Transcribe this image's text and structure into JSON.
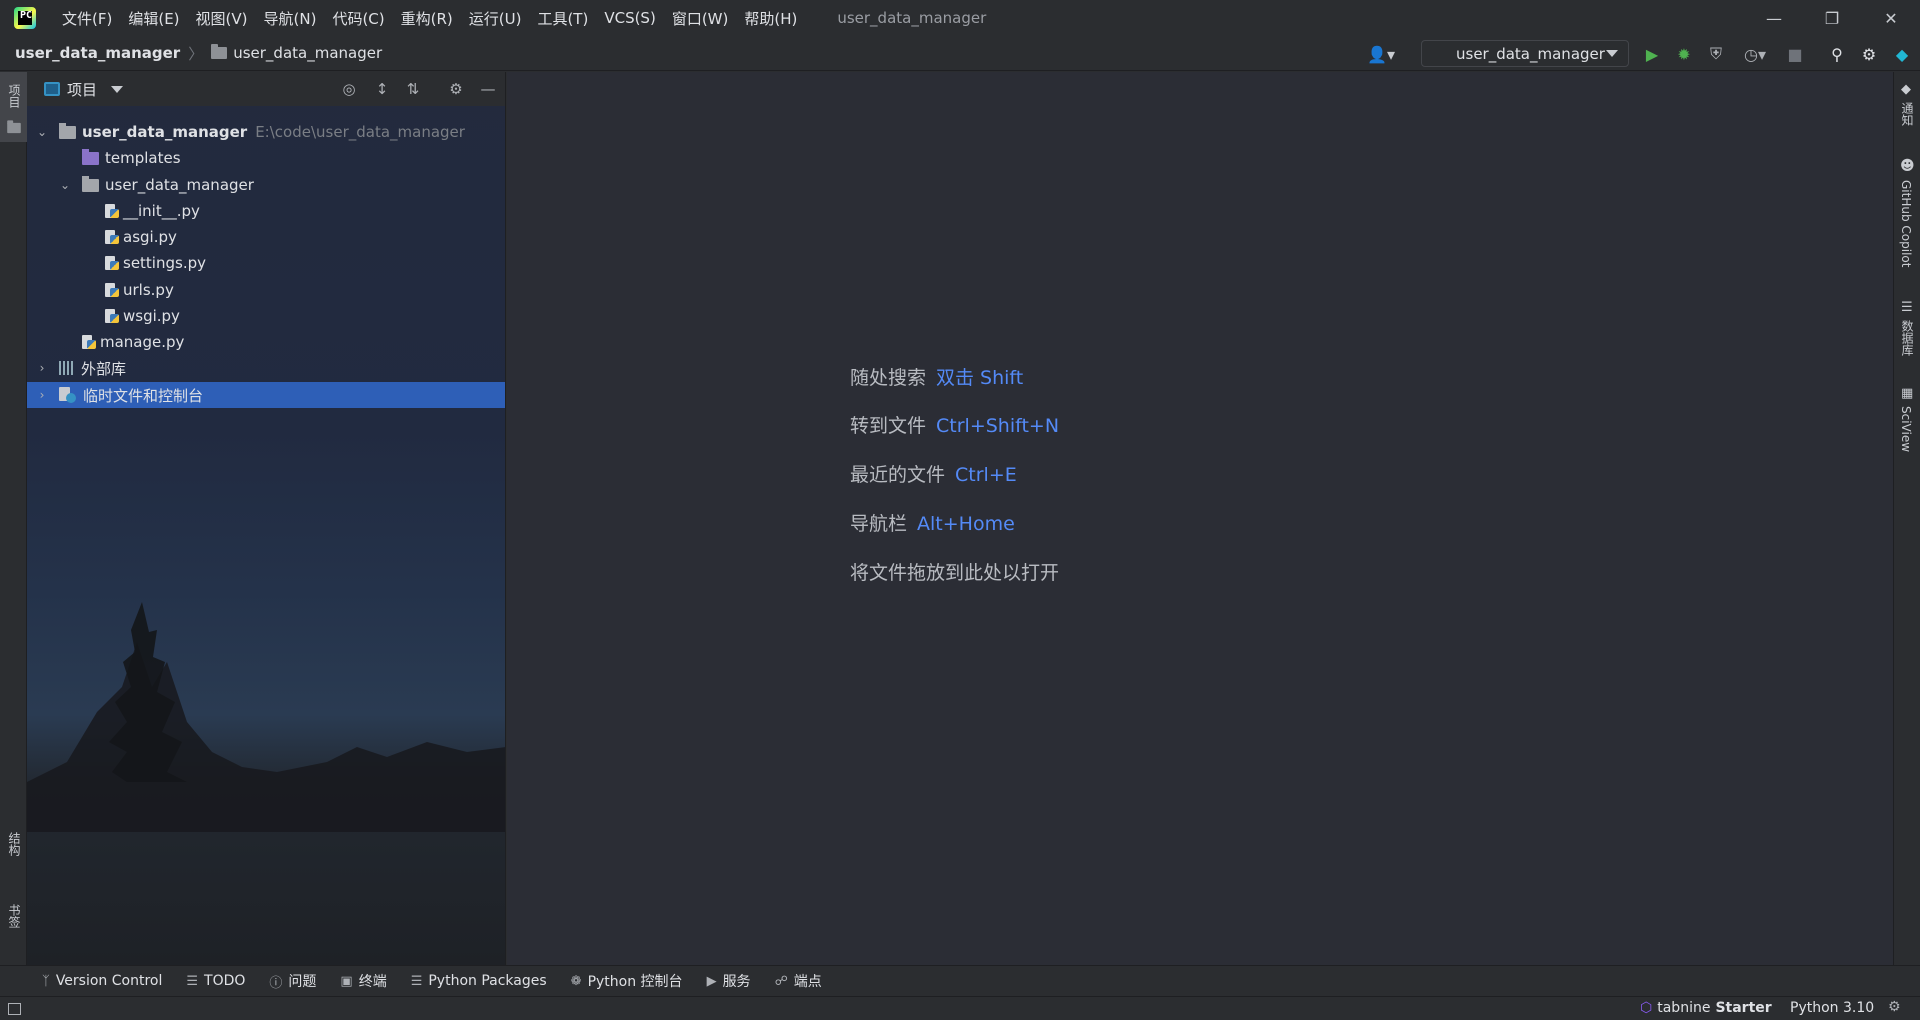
{
  "titlebar": {
    "menus": [
      "文件(F)",
      "编辑(E)",
      "视图(V)",
      "导航(N)",
      "代码(C)",
      "重构(R)",
      "运行(U)",
      "工具(T)",
      "VCS(S)",
      "窗口(W)",
      "帮助(H)"
    ],
    "title": "user_data_manager",
    "logo_text": "PC"
  },
  "navbar": {
    "root": "user_data_manager",
    "leaf": "user_data_manager",
    "run_config": "user_data_manager"
  },
  "left_strip": {
    "project": "项目",
    "structure": "结构",
    "bookmarks": "书签"
  },
  "project_panel": {
    "title": "项目",
    "tree": [
      {
        "label": "user_data_manager",
        "path": "E:\\code\\user_data_manager"
      },
      {
        "label": "templates"
      },
      {
        "label": "user_data_manager"
      },
      {
        "label": "__init__.py"
      },
      {
        "label": "asgi.py"
      },
      {
        "label": "settings.py"
      },
      {
        "label": "urls.py"
      },
      {
        "label": "wsgi.py"
      },
      {
        "label": "manage.py"
      },
      {
        "label": "外部库"
      },
      {
        "label": "临时文件和控制台"
      }
    ]
  },
  "editor": {
    "hints": [
      {
        "label": "随处搜索",
        "key": "双击 Shift"
      },
      {
        "label": "转到文件",
        "key": "Ctrl+Shift+N"
      },
      {
        "label": "最近的文件",
        "key": "Ctrl+E"
      },
      {
        "label": "导航栏",
        "key": "Alt+Home"
      },
      {
        "label": "将文件拖放到此处以打开",
        "key": ""
      }
    ]
  },
  "right_strip": {
    "notifications": "通知",
    "copilot": "GitHub Copilot",
    "database": "数据库",
    "sciview": "SciView"
  },
  "bottom_tools": [
    "Version Control",
    "TODO",
    "问题",
    "终端",
    "Python Packages",
    "Python 控制台",
    "服务",
    "端点"
  ],
  "statusbar": {
    "tabnine": "tabnine",
    "tabnine_plan": "Starter",
    "interpreter": "Python 3.10"
  },
  "colors": {
    "accent_key": "#548af7",
    "selection": "#2e5fb7",
    "run_green": "#4fb250"
  }
}
